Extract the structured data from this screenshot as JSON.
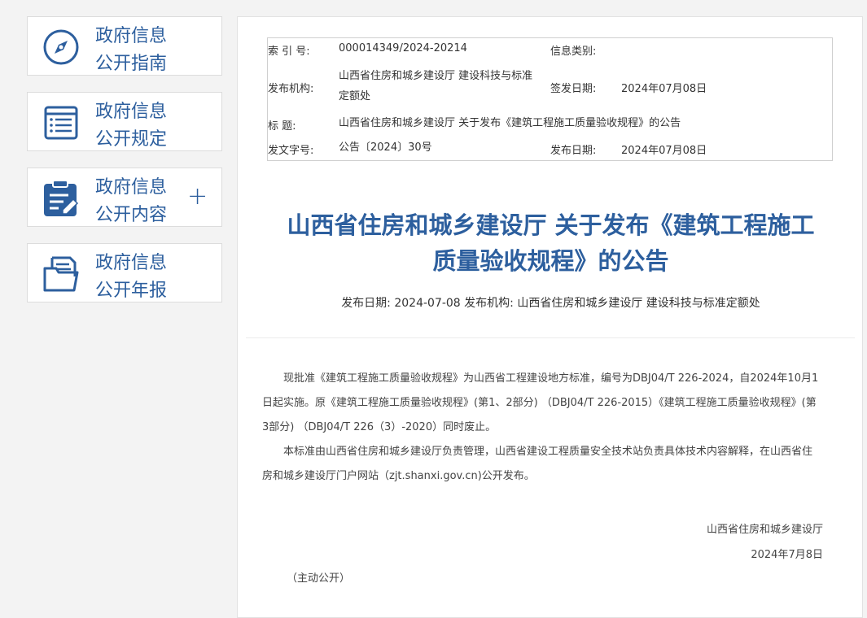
{
  "sidebar": {
    "items": [
      {
        "line1": "政府信息",
        "line2": "公开指南",
        "icon": "compass-icon"
      },
      {
        "line1": "政府信息",
        "line2": "公开规定",
        "icon": "list-document-icon"
      },
      {
        "line1": "政府信息",
        "line2": "公开内容",
        "icon": "edit-clipboard-icon",
        "expand": "+"
      },
      {
        "line1": "政府信息",
        "line2": "公开年报",
        "icon": "folder-document-icon"
      }
    ]
  },
  "meta": {
    "index_label": "索  引 号:",
    "index_value": "000014349/2024-20214",
    "category_label": "信息类别:",
    "category_value": "",
    "org_label": "发布机构:",
    "org_value": "山西省住房和城乡建设厅 建设科技与标准定额处",
    "sign_date_label": "签发日期:",
    "sign_date_value": "2024年07月08日",
    "title_label": "标      题:",
    "title_value": "山西省住房和城乡建设厅 关于发布《建筑工程施工质量验收规程》的公告",
    "doc_no_label": "发文字号:",
    "doc_no_value": "公告〔2024〕30号",
    "pub_date_label": "发布日期:",
    "pub_date_value": "2024年07月08日"
  },
  "article": {
    "title_line1": "山西省住房和城乡建设厅 关于发布《建筑工程施工",
    "title_line2": "质量验收规程》的公告",
    "subline": "发布日期: 2024-07-08 发布机构: 山西省住房和城乡建设厅 建设科技与标准定额处",
    "para1": "现批准《建筑工程施工质量验收规程》为山西省工程建设地方标准，编号为DBJ04/T 226-2024，自2024年10月1日起实施。原《建筑工程施工质量验收规程》(第1、2部分) （DBJ04/T 226-2015）《建筑工程施工质量验收规程》(第3部分) （DBJ04/T 226（3）-2020）同时废止。",
    "para2": "本标准由山西省住房和城乡建设厅负责管理，山西省建设工程质量安全技术站负责具体技术内容解释，在山西省住房和城乡建设厅门户网站（zjt.shanxi.gov.cn)公开发布。",
    "signer": "山西省住房和城乡建设厅",
    "sign_date": "2024年7月8日",
    "open_note": "（主动公开）"
  },
  "colors": {
    "accent": "#2d5f9e",
    "background": "#f3f3f3"
  }
}
